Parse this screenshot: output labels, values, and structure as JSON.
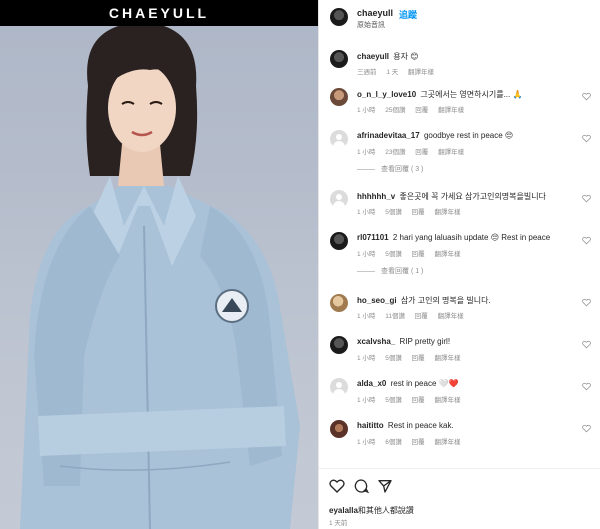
{
  "photo": {
    "brand": "CHAEYULL"
  },
  "header": {
    "username": "chaeyull",
    "follow_label": "追蹤",
    "subtitle": "原始音訊"
  },
  "comments": [
    {
      "user": "chaeyull",
      "text": "용자",
      "emoji": "😊",
      "meta": [
        "三週前",
        "1 天",
        "翻譯年樣"
      ],
      "avatar": "dark"
    },
    {
      "user": "o_n_l_y_love10",
      "text": "그곳에서는 영면하시기를...",
      "emoji": "🙏",
      "meta": [
        "1 小時",
        "25個讚",
        "回覆",
        "翻譯年樣"
      ],
      "avatar": "brown"
    },
    {
      "user": "afrinadevitaa_17",
      "text": "goodbye rest in peace",
      "emoji": "😔",
      "meta": [
        "1 小時",
        "23個讚",
        "回覆",
        "翻譯年樣"
      ],
      "avatar": "grey",
      "replies": "查看回覆 ( 3 )"
    },
    {
      "user": "hhhhhh_v",
      "text": "좋은곳에 꼭 가세요 삼가고인의명복을빌니다",
      "emoji": "",
      "meta": [
        "1 小時",
        "5個讚",
        "回覆",
        "翻譯年樣"
      ],
      "avatar": "grey"
    },
    {
      "user": "rl071101",
      "text": "2 hari yang lalu",
      "extra_user": "asih update",
      "emoji": "😔",
      "tail": "Rest in peace",
      "meta": [
        "1 小時",
        "5個讚",
        "回覆",
        "翻譯年樣"
      ],
      "avatar": "dark",
      "replies": "查看回覆 ( 1 )"
    },
    {
      "user": "ho_seo_gi",
      "text": "삼가 고인의 명복을 빌니다.",
      "emoji": "",
      "meta": [
        "1 小時",
        "11個讚",
        "回覆",
        "翻譯年樣"
      ],
      "avatar": "tan"
    },
    {
      "user": "xcalvsha_",
      "text": "RIP pretty girl!",
      "emoji": "",
      "meta": [
        "1 小時",
        "5個讚",
        "回覆",
        "翻譯年樣"
      ],
      "avatar": "dark"
    },
    {
      "user": "alda_x0",
      "text": "rest in peace",
      "emoji": "🤍❤️",
      "meta": [
        "1 小時",
        "5個讚",
        "回覆",
        "翻譯年樣"
      ],
      "avatar": "grey"
    },
    {
      "user": "haititto",
      "text": "Rest in peace kak.",
      "emoji": "",
      "meta": [
        "1 小時",
        "6個讚",
        "回覆",
        "翻譯年樣"
      ],
      "avatar": "maroon"
    }
  ],
  "footer": {
    "liked_user": "eyalalla",
    "liked_text": "和其他人都說讚",
    "posted": "1 天前"
  },
  "colors": {
    "accent": "#0095f6",
    "jacket": "#a9c2d8",
    "sky": "#b5bdcc"
  }
}
